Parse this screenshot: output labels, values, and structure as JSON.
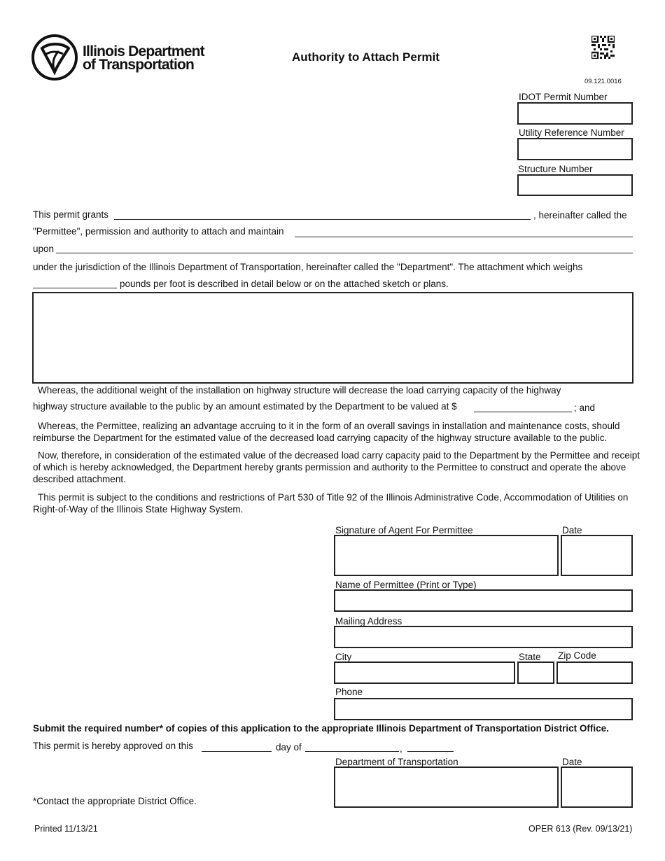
{
  "header": {
    "logo_line1": "Illinois Department",
    "logo_line2": "of Transportation",
    "title": "Authority to Attach Permit",
    "form_code": "09.121.0016",
    "qr_icon": "qr-code"
  },
  "id_fields": [
    {
      "label": "IDOT Permit Number",
      "value": ""
    },
    {
      "label": "Utility Reference Number",
      "value": ""
    },
    {
      "label": "Structure Number",
      "value": ""
    }
  ],
  "grant": {
    "line1_prefix": "This permit grants",
    "line1_suffix": ", hereinafter called the",
    "line2_prefix": "\"Permittee\", permission and authority to attach and maintain",
    "line3_prefix": "upon",
    "line4": "under the jurisdiction of the Illinois Department of Transportation, hereinafter called the \"Department\".  The attachment which weighs",
    "line5_suffix": "pounds per foot is described in detail below or on the attached sketch or plans.",
    "grantee_value": "",
    "attachment_value": "",
    "upon_value": "",
    "weight_value": "",
    "description_value": ""
  },
  "whereas1": {
    "line1": "Whereas, the additional weight of the installation on highway structure will decrease the load carrying capacity of the highway",
    "line2_prefix": "highway structure available to the public by an amount estimated by the Department to be valued at $",
    "line2_suffix": "; and",
    "amount_value": ""
  },
  "whereas2": "Whereas, the Permittee, realizing an advantage accruing to it in the form of an overall savings in installation and maintenance costs, should reimburse the Department for the estimated value of the decreased load carrying capacity of the highway structure available to the public.",
  "now_therefore": "Now, therefore, in consideration of the estimated value of the decreased load carry capacity paid to the Department by the Permittee and receipt of which is hereby acknowledged, the Department hereby grants permission and authority to the Permittee to construct and operate the above described attachment.",
  "subject_to": "This permit is subject to the conditions and restrictions of Part 530 of Title 92 of the Illinois Administrative Code, Accommodation of Utilities on Right-of-Way of the Illinois State Highway System.",
  "permittee": {
    "signature_label": "Signature of Agent For Permittee",
    "date_label": "Date",
    "name_label": "Name of Permittee (Print or Type)",
    "address_label": "Mailing Address",
    "city_label": "City",
    "state_label": "State",
    "zip_label": "Zip Code",
    "phone_label": "Phone"
  },
  "submit_notice": "Submit the required number* of copies of this application to the appropriate Illinois Department of Transportation District Office.",
  "approval": {
    "prefix": "This permit is hereby approved on this",
    "day_of": "day of",
    "comma": ",",
    "day_value": "",
    "month_value": "",
    "year_value": "",
    "dept_label": "Department of Transportation",
    "date_label": "Date"
  },
  "footnote": "*Contact the appropriate District Office.",
  "footer": {
    "printed": "Printed 11/13/21",
    "form_rev": "OPER 613 (Rev. 09/13/21)"
  }
}
